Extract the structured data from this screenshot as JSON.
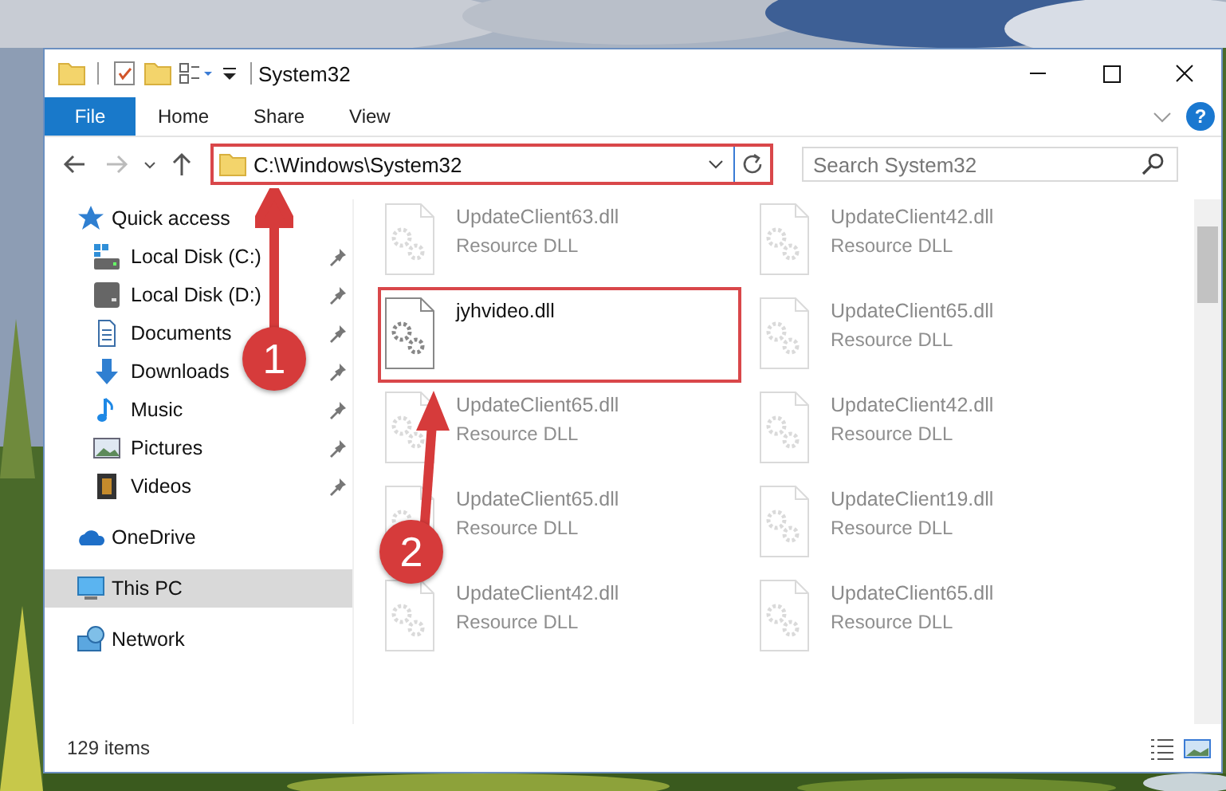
{
  "window": {
    "title": "System32"
  },
  "ribbon": {
    "tabs": [
      {
        "label": "File",
        "kind": "file"
      },
      {
        "label": "Home",
        "kind": "tab"
      },
      {
        "label": "Share",
        "kind": "tab"
      },
      {
        "label": "View",
        "kind": "tab"
      }
    ],
    "help": "?"
  },
  "address_bar": {
    "path": "C:\\Windows\\System32",
    "search_placeholder": "Search System32"
  },
  "sidebar": {
    "items": [
      {
        "label": "Quick access",
        "kind": "star",
        "selected": false,
        "children": [
          {
            "label": "Local Disk (C:)",
            "kind": "system-drive",
            "pinned": true,
            "selected": false
          },
          {
            "label": "Local Disk (D:)",
            "kind": "drive",
            "pinned": true,
            "selected": false
          },
          {
            "label": "Documents",
            "kind": "documents",
            "pinned": true,
            "selected": false
          },
          {
            "label": "Downloads",
            "kind": "downloads",
            "pinned": true,
            "selected": false
          },
          {
            "label": "Music",
            "kind": "music",
            "pinned": true,
            "selected": false
          },
          {
            "label": "Pictures",
            "kind": "pictures",
            "pinned": true,
            "selected": false
          },
          {
            "label": "Videos",
            "kind": "videos",
            "pinned": true,
            "selected": false
          }
        ]
      },
      {
        "label": "OneDrive",
        "kind": "cloud",
        "selected": false
      },
      {
        "label": "This PC",
        "kind": "computer",
        "selected": true
      },
      {
        "label": "Network",
        "kind": "network",
        "selected": false
      }
    ]
  },
  "files": [
    {
      "name": "UpdateClient63.dll",
      "type": "Resource DLL",
      "faded": true
    },
    {
      "name": "UpdateClient42.dll",
      "type": "Resource DLL",
      "faded": true
    },
    {
      "name": "jyhvideo.dll",
      "faded": false,
      "highlighted": true
    },
    {
      "name": "UpdateClient65.dll",
      "type": "Resource DLL",
      "faded": true
    },
    {
      "name": "UpdateClient65.dll",
      "type": "Resource DLL",
      "faded": true
    },
    {
      "name": "UpdateClient42.dll",
      "type": "Resource DLL",
      "faded": true
    },
    {
      "name": "UpdateClient65.dll",
      "type": "Resource DLL",
      "faded": true
    },
    {
      "name": "UpdateClient19.dll",
      "type": "Resource DLL",
      "faded": true
    },
    {
      "name": "UpdateClient42.dll",
      "type": "Resource DLL",
      "faded": true
    },
    {
      "name": "UpdateClient65.dll",
      "type": "Resource DLL",
      "faded": true
    }
  ],
  "status_bar": {
    "count": "129 items"
  },
  "callouts": [
    {
      "number": "1"
    },
    {
      "number": "2"
    }
  ]
}
